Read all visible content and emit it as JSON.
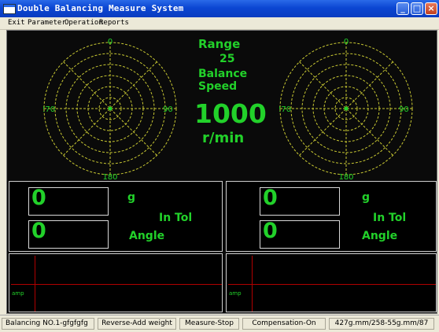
{
  "window": {
    "title": "Double Balancing Measure System",
    "minimize": "_",
    "maximize": "□",
    "close": "×"
  },
  "menu": [
    "Exit",
    "Parameter",
    "Operation",
    "Reports"
  ],
  "center": {
    "range_label": "Range",
    "range_value": "25",
    "balance_speed_label_1": "Balance",
    "balance_speed_label_2": "Speed",
    "speed_value": "1000",
    "speed_unit": "r/min"
  },
  "polar_left": {
    "label_top": "0",
    "label_right": "90",
    "label_bottom": "180",
    "label_left": "270"
  },
  "polar_right": {
    "label_top": "0",
    "label_right": "90",
    "label_bottom": "180",
    "label_left": "270"
  },
  "left_panel": {
    "weight_value": "0",
    "angle_value": "0",
    "unit": "g",
    "tol": "In Tol",
    "angle_label": "Angle"
  },
  "right_panel": {
    "weight_value": "0",
    "angle_value": "0",
    "unit": "g",
    "tol": "In Tol",
    "angle_label": "Angle"
  },
  "plot_left": {
    "axis_label": "amp"
  },
  "plot_right": {
    "axis_label": "amp"
  },
  "status": {
    "balancing_no": "Balancing NO.1-gfgfgfg",
    "mode": "Reverse-Add weight",
    "measure": "Measure-Stop",
    "compensation": "Compensation-On",
    "readout": "427g.mm/258-55g.mm/87"
  },
  "colors": {
    "display_green": "#22d12a",
    "polar_grid": "#c8c832",
    "crosshair": "#b00000"
  }
}
